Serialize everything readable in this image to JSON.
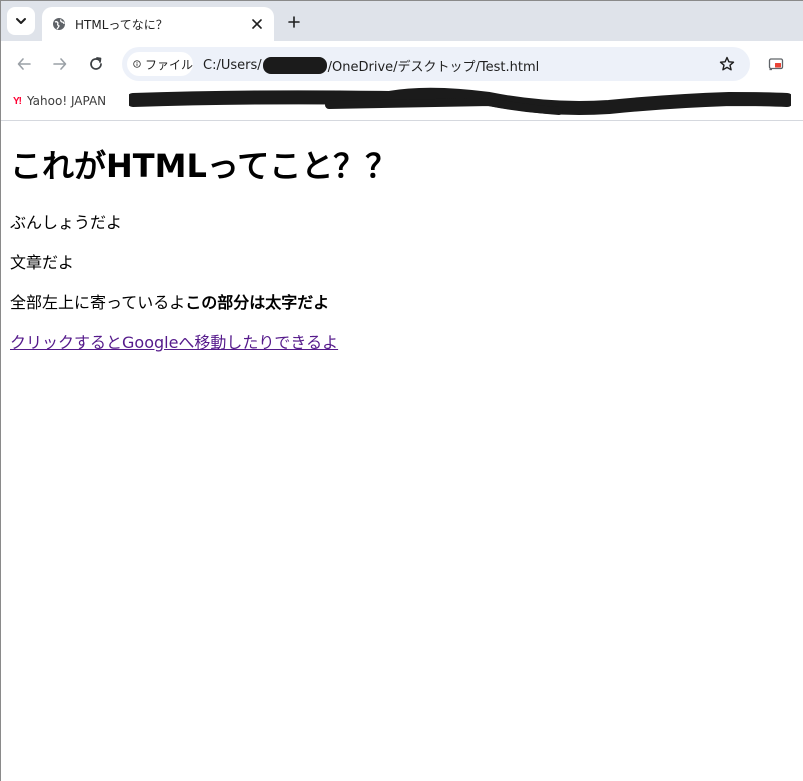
{
  "browser": {
    "tab": {
      "title": "HTMLってなに？"
    },
    "omnibox": {
      "site_chip": "ファイル",
      "url_prefix": "C:/Users/",
      "url_suffix": "/OneDrive/デスクトップ/Test.html"
    },
    "bookmarks": [
      {
        "label": "Yahoo! JAPAN",
        "icon": "Y!"
      }
    ],
    "icons": {
      "tab_search": "chevron-down-icon",
      "favicon": "globe-icon",
      "close": "close-icon",
      "new_tab": "plus-icon",
      "back": "arrow-left-icon",
      "forward": "arrow-right-icon",
      "reload": "reload-icon",
      "info": "info-icon",
      "bookmark_star": "star-icon",
      "extension": "cast-icon"
    }
  },
  "page": {
    "heading": "これがHTMLってこと？？",
    "paragraph1": "ぶんしょうだよ",
    "paragraph2": "文章だよ",
    "paragraph3_normal": "全部左上に寄っているよ",
    "paragraph3_bold": "この部分は太字だよ",
    "link": "クリックするとGoogleへ移動したりできるよ"
  },
  "colors": {
    "tabstrip_bg": "#dfe3ea",
    "omnibox_bg": "#edf1f9",
    "visited_link": "#551a8b",
    "yahoo_red": "#ff0033"
  }
}
